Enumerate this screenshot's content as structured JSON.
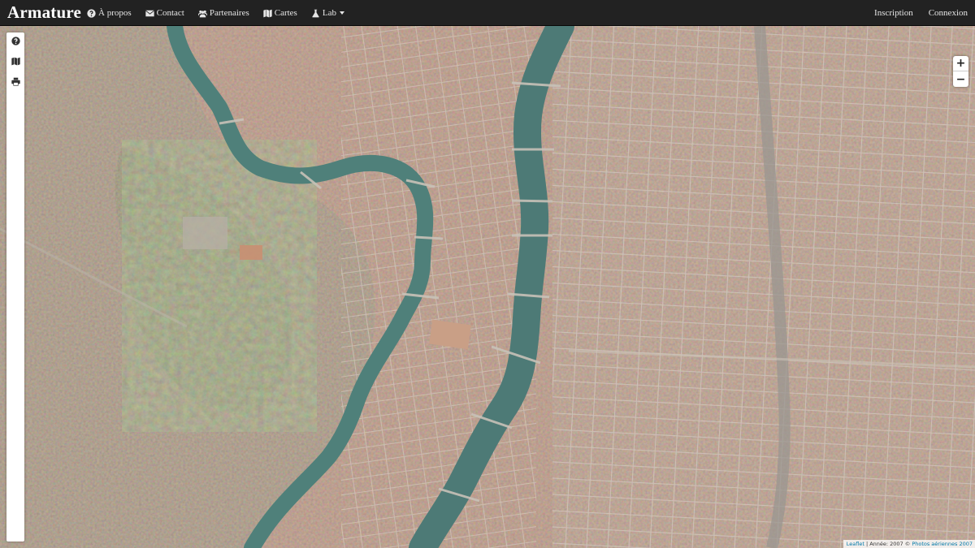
{
  "navbar": {
    "brand": "Armature",
    "left_items": [
      {
        "label": "À propos",
        "icon": "question-circle-icon"
      },
      {
        "label": "Contact",
        "icon": "envelope-icon"
      },
      {
        "label": "Partenaires",
        "icon": "users-icon"
      },
      {
        "label": "Cartes",
        "icon": "map-icon"
      },
      {
        "label": "Lab",
        "icon": "flask-icon",
        "has_dropdown": true
      }
    ],
    "right_items": [
      {
        "label": "Inscription"
      },
      {
        "label": "Connexion"
      }
    ]
  },
  "sidebar": {
    "tools": [
      {
        "icon": "question-circle-icon"
      },
      {
        "icon": "map-icon"
      },
      {
        "icon": "print-icon"
      }
    ]
  },
  "zoom": {
    "in_label": "+",
    "out_label": "−"
  },
  "attribution": {
    "leaflet": "Leaflet",
    "separator": " | Année: 2007 © ",
    "source": "Photos aériennes 2007"
  },
  "map": {
    "imagery": "aerial photograph of a city with two rivers",
    "colors": {
      "roofs": "#b07760",
      "river": "#4f807a",
      "vegetation": "#6f7a52"
    }
  }
}
